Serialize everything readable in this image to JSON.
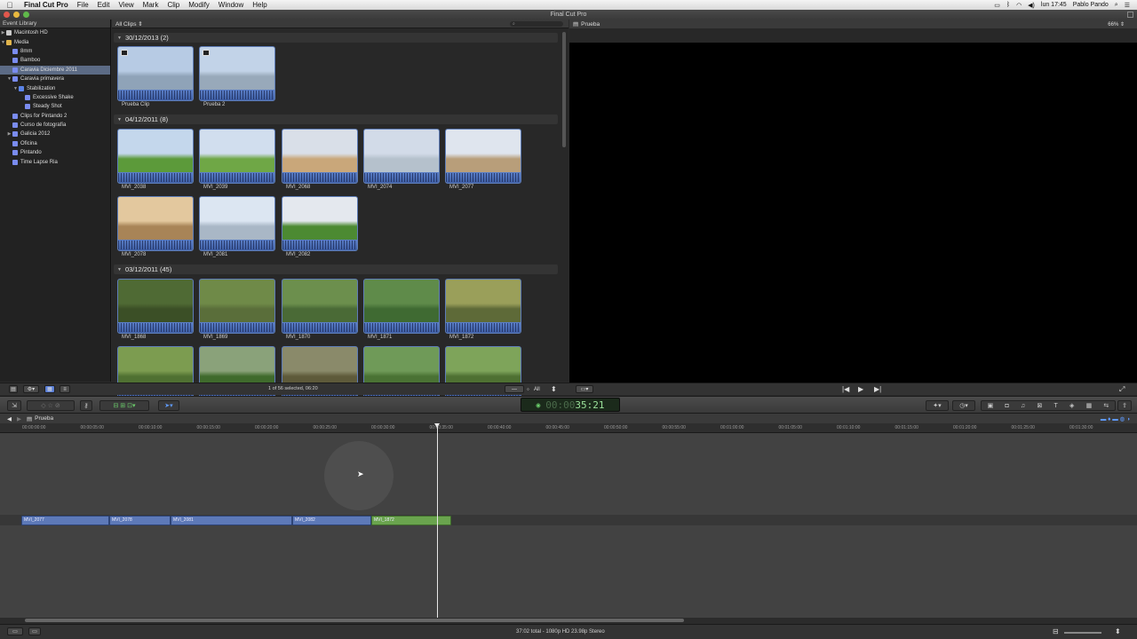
{
  "menubar": {
    "app": "Final Cut Pro",
    "menus": [
      "File",
      "Edit",
      "View",
      "Mark",
      "Clip",
      "Modify",
      "Window",
      "Help"
    ],
    "clock": "lun 17:45",
    "user": "Pablo Pando"
  },
  "window": {
    "title": "Final Cut Pro"
  },
  "library": {
    "header": "Event Library",
    "items": [
      {
        "label": "Macintosh HD",
        "indent": 0,
        "tri": "▶",
        "icon": "hd"
      },
      {
        "label": "Media",
        "indent": 0,
        "tri": "▼",
        "icon": "folder"
      },
      {
        "label": "8mm",
        "indent": 1,
        "tri": "",
        "icon": "event"
      },
      {
        "label": "Bamboo",
        "indent": 1,
        "tri": "",
        "icon": "event"
      },
      {
        "label": "Caravia Diciembre 2011",
        "indent": 1,
        "tri": "",
        "icon": "event",
        "selected": true
      },
      {
        "label": "Caravia primavera",
        "indent": 1,
        "tri": "▼",
        "icon": "event"
      },
      {
        "label": "Stabilization",
        "indent": 2,
        "tri": "▼",
        "icon": "folder-blue"
      },
      {
        "label": "Excessive Shake",
        "indent": 3,
        "tri": "",
        "icon": "event"
      },
      {
        "label": "Steady Shot",
        "indent": 3,
        "tri": "",
        "icon": "event"
      },
      {
        "label": "Clips for Pintando 2",
        "indent": 1,
        "tri": "",
        "icon": "event"
      },
      {
        "label": "Curso de fotografía",
        "indent": 1,
        "tri": "",
        "icon": "event"
      },
      {
        "label": "Galicia 2012",
        "indent": 1,
        "tri": "▶",
        "icon": "event"
      },
      {
        "label": "Oficina",
        "indent": 1,
        "tri": "",
        "icon": "event"
      },
      {
        "label": "Pintando",
        "indent": 1,
        "tri": "",
        "icon": "event"
      },
      {
        "label": "Time Lapse Ria",
        "indent": 1,
        "tri": "",
        "icon": "event"
      }
    ]
  },
  "browser": {
    "filter": "All Clips ⇕",
    "groups": [
      {
        "label": "30/12/2013  (2)"
      },
      {
        "label": "04/12/2011  (8)"
      },
      {
        "label": "03/12/2011  (45)"
      }
    ],
    "clips": [
      {
        "label": "Prueba Clip",
        "sky": "#b7cbe4",
        "ground": "#8fa3b8",
        "badge": true
      },
      {
        "label": "Prueba 2",
        "sky": "#c2d3e8",
        "ground": "#98a9ba",
        "badge": true
      },
      {
        "label": "MVI_2038",
        "sky": "#c4d7ec",
        "ground": "#5c9a3a"
      },
      {
        "label": "MVI_2039",
        "sky": "#d1deee",
        "ground": "#6fa746"
      },
      {
        "label": "MVI_2068",
        "sky": "#d9dfe8",
        "ground": "#c9a77a"
      },
      {
        "label": "MVI_2074",
        "sky": "#d2dbe8",
        "ground": "#b5c1cc"
      },
      {
        "label": "MVI_2077",
        "sky": "#dfe5ee",
        "ground": "#b89e7a"
      },
      {
        "label": "MVI_2078",
        "sky": "#e3c89e",
        "ground": "#a88457"
      },
      {
        "label": "MVI_2081",
        "sky": "#dce6f2",
        "ground": "#a9b7c6"
      },
      {
        "label": "MVI_2082",
        "sky": "#e4e8ee",
        "ground": "#4c8a32"
      },
      {
        "label": "MVI_1868",
        "sky": "#4f6a34",
        "ground": "#3b4f26"
      },
      {
        "label": "MVI_1869",
        "sky": "#6f8a48",
        "ground": "#5a6e3a"
      },
      {
        "label": "MVI_1870",
        "sky": "#6c8f4d",
        "ground": "#4a6a36"
      },
      {
        "label": "MVI_1871",
        "sky": "#5f8b4a",
        "ground": "#3f6a32"
      },
      {
        "label": "MVI_1872",
        "sky": "#9a9f5a",
        "ground": "#5e6a38"
      },
      {
        "label": "",
        "sky": "#7c9c50",
        "ground": "#4f7032"
      },
      {
        "label": "",
        "sky": "#8aa27a",
        "ground": "#3f6a2c"
      },
      {
        "label": "",
        "sky": "#8a8a6a",
        "ground": "#5e5a3a"
      },
      {
        "label": "",
        "sky": "#6f9a58",
        "ground": "#4a7234"
      },
      {
        "label": "",
        "sky": "#7ea45a",
        "ground": "#4e7032"
      }
    ],
    "selection_info": "1 of 56 selected, 06:20",
    "all_label": "All"
  },
  "viewer": {
    "title": "Prueba",
    "zoom": "66% ⇕"
  },
  "toolbar": {
    "timecode_dim": "00:00",
    "timecode": "35:21"
  },
  "timeline": {
    "project": "Prueba",
    "ruler": [
      "00:00:00:00",
      "00:00:05:00",
      "00:00:10:00",
      "00:00:15:00",
      "00:00:20:00",
      "00:00:25:00",
      "00:00:30:00",
      "00:00:35:00",
      "00:00:40:00",
      "00:00:45:00",
      "00:00:50:00",
      "00:00:55:00",
      "00:01:00:00",
      "00:01:05:00",
      "00:01:10:00",
      "00:01:15:00",
      "00:01:20:00",
      "00:01:25:00",
      "00:01:30:00"
    ],
    "clips": [
      "MVI_2077",
      "MVI_2078",
      "MVI_2081",
      "MVI_2082",
      "MVI_1872"
    ]
  },
  "status": "37:02 total - 1080p HD 23.98p Stereo",
  "colors": {
    "accent": "#5b7fd6",
    "timecode": "#9be29b",
    "clip_blue": "#5d79b8",
    "clip_green": "#6aa44e",
    "selection": "#5c6b85"
  }
}
